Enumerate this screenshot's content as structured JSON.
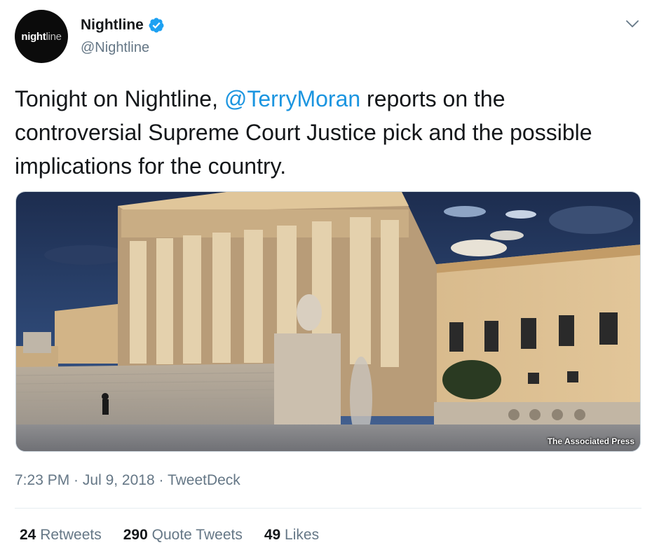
{
  "author": {
    "avatar_text_bold": "night",
    "avatar_text_light": "line",
    "display_name": "Nightline",
    "handle": "@Nightline",
    "verified": true
  },
  "tweet": {
    "text_before": "Tonight on Nightline, ",
    "mention": "@TerryMoran",
    "text_after": " reports on the controversial Supreme Court Justice pick and the possible implications for the country."
  },
  "media": {
    "credit": "The Associated Press"
  },
  "meta": {
    "time": "7:23 PM",
    "sep1": " · ",
    "date": "Jul 9, 2018",
    "sep2": " · ",
    "source": "TweetDeck"
  },
  "stats": {
    "retweets_count": "24",
    "retweets_label": "Retweets",
    "quotes_count": "290",
    "quotes_label": "Quote Tweets",
    "likes_count": "49",
    "likes_label": "Likes"
  },
  "colors": {
    "link": "#1b95e0",
    "secondary": "#657786",
    "primary": "#14171a"
  },
  "icons": {
    "verified": "verified-badge-icon",
    "menu": "chevron-down-icon"
  }
}
